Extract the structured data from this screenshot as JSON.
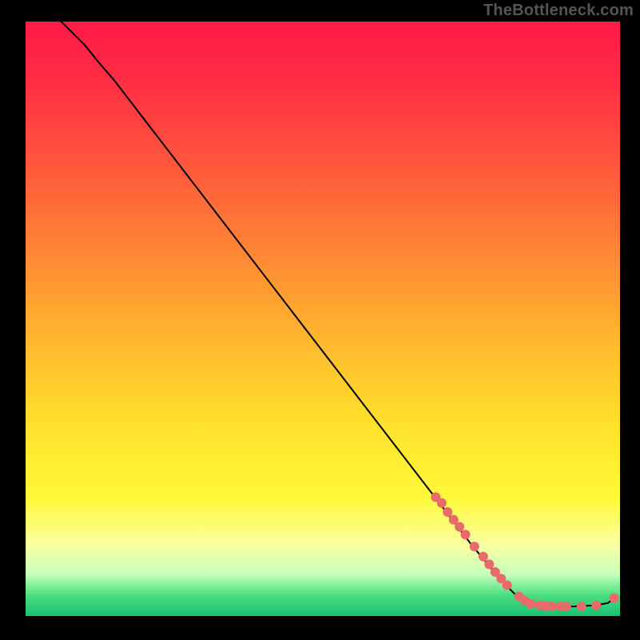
{
  "watermark": "TheBottleneck.com",
  "colors": {
    "marker": "#e86a6a",
    "line": "#000000"
  },
  "chart_data": {
    "type": "line",
    "title": "",
    "xlabel": "",
    "ylabel": "",
    "xlim": [
      0,
      100
    ],
    "ylim": [
      0,
      100
    ],
    "curve": [
      {
        "x": 6,
        "y": 100
      },
      {
        "x": 7,
        "y": 99
      },
      {
        "x": 8.5,
        "y": 97.5
      },
      {
        "x": 10,
        "y": 96
      },
      {
        "x": 12,
        "y": 93.5
      },
      {
        "x": 15,
        "y": 90
      },
      {
        "x": 20,
        "y": 83.5
      },
      {
        "x": 30,
        "y": 70.5
      },
      {
        "x": 40,
        "y": 57.5
      },
      {
        "x": 50,
        "y": 44.5
      },
      {
        "x": 60,
        "y": 31.5
      },
      {
        "x": 70,
        "y": 18.5
      },
      {
        "x": 75,
        "y": 12
      },
      {
        "x": 80,
        "y": 6
      },
      {
        "x": 83,
        "y": 3
      },
      {
        "x": 85,
        "y": 2
      },
      {
        "x": 88,
        "y": 1.6
      },
      {
        "x": 92,
        "y": 1.6
      },
      {
        "x": 96,
        "y": 1.8
      },
      {
        "x": 98,
        "y": 2.2
      },
      {
        "x": 99,
        "y": 3
      }
    ],
    "markers": [
      {
        "x": 69,
        "y": 20,
        "r": 6
      },
      {
        "x": 70,
        "y": 19,
        "r": 6
      },
      {
        "x": 71,
        "y": 17.5,
        "r": 6
      },
      {
        "x": 72,
        "y": 16.2,
        "r": 6
      },
      {
        "x": 73,
        "y": 15,
        "r": 6
      },
      {
        "x": 74,
        "y": 13.7,
        "r": 6
      },
      {
        "x": 75.5,
        "y": 11.7,
        "r": 6
      },
      {
        "x": 77,
        "y": 10,
        "r": 6
      },
      {
        "x": 78,
        "y": 8.7,
        "r": 6
      },
      {
        "x": 79,
        "y": 7.4,
        "r": 6
      },
      {
        "x": 80,
        "y": 6.3,
        "r": 6
      },
      {
        "x": 81,
        "y": 5.2,
        "r": 6
      },
      {
        "x": 83,
        "y": 3.3,
        "r": 6
      },
      {
        "x": 84,
        "y": 2.6,
        "r": 6
      },
      {
        "x": 85,
        "y": 2.0,
        "r": 6
      },
      {
        "x": 86.5,
        "y": 1.8,
        "r": 6
      },
      {
        "x": 87.5,
        "y": 1.7,
        "r": 6
      },
      {
        "x": 88.5,
        "y": 1.6,
        "r": 6
      },
      {
        "x": 90,
        "y": 1.6,
        "r": 6
      },
      {
        "x": 91,
        "y": 1.6,
        "r": 6
      },
      {
        "x": 93.5,
        "y": 1.6,
        "r": 6
      },
      {
        "x": 96,
        "y": 1.8,
        "r": 6
      },
      {
        "x": 99,
        "y": 3.0,
        "r": 6
      }
    ]
  }
}
